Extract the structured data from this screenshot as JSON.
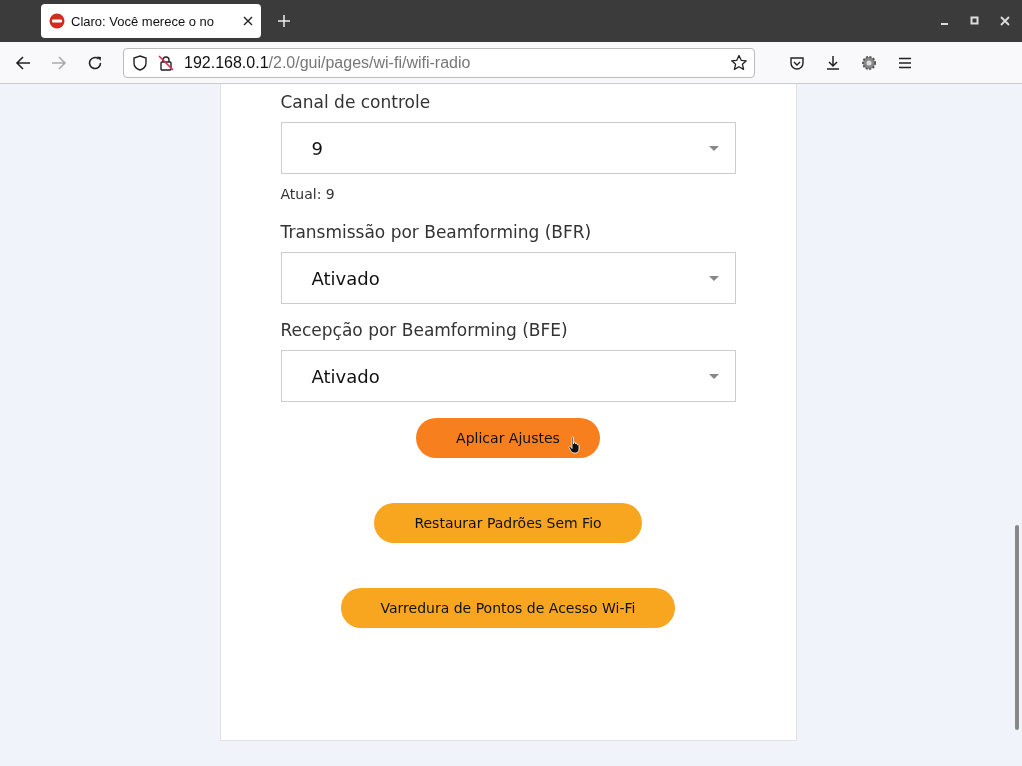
{
  "browser": {
    "tab": {
      "title": "Claro: Você merece o no",
      "selected": true
    },
    "url_host": "192.168.0.1",
    "url_path": "/2.0/gui/pages/wi-fi/wifi-radio"
  },
  "fields": [
    {
      "label": "Canal de controle",
      "value": "9",
      "note": "Atual: 9"
    },
    {
      "label": "Transmissão por Beamforming (BFR)",
      "value": "Ativado"
    },
    {
      "label": "Recepção por Beamforming (BFE)",
      "value": "Ativado"
    }
  ],
  "buttons": [
    {
      "label": "Aplicar Ajustes",
      "hovered": true
    },
    {
      "label": "Restaurar Padrões Sem Fio",
      "hovered": false
    },
    {
      "label": "Varredura de Pontos de Acesso Wi-Fi",
      "hovered": false
    }
  ]
}
